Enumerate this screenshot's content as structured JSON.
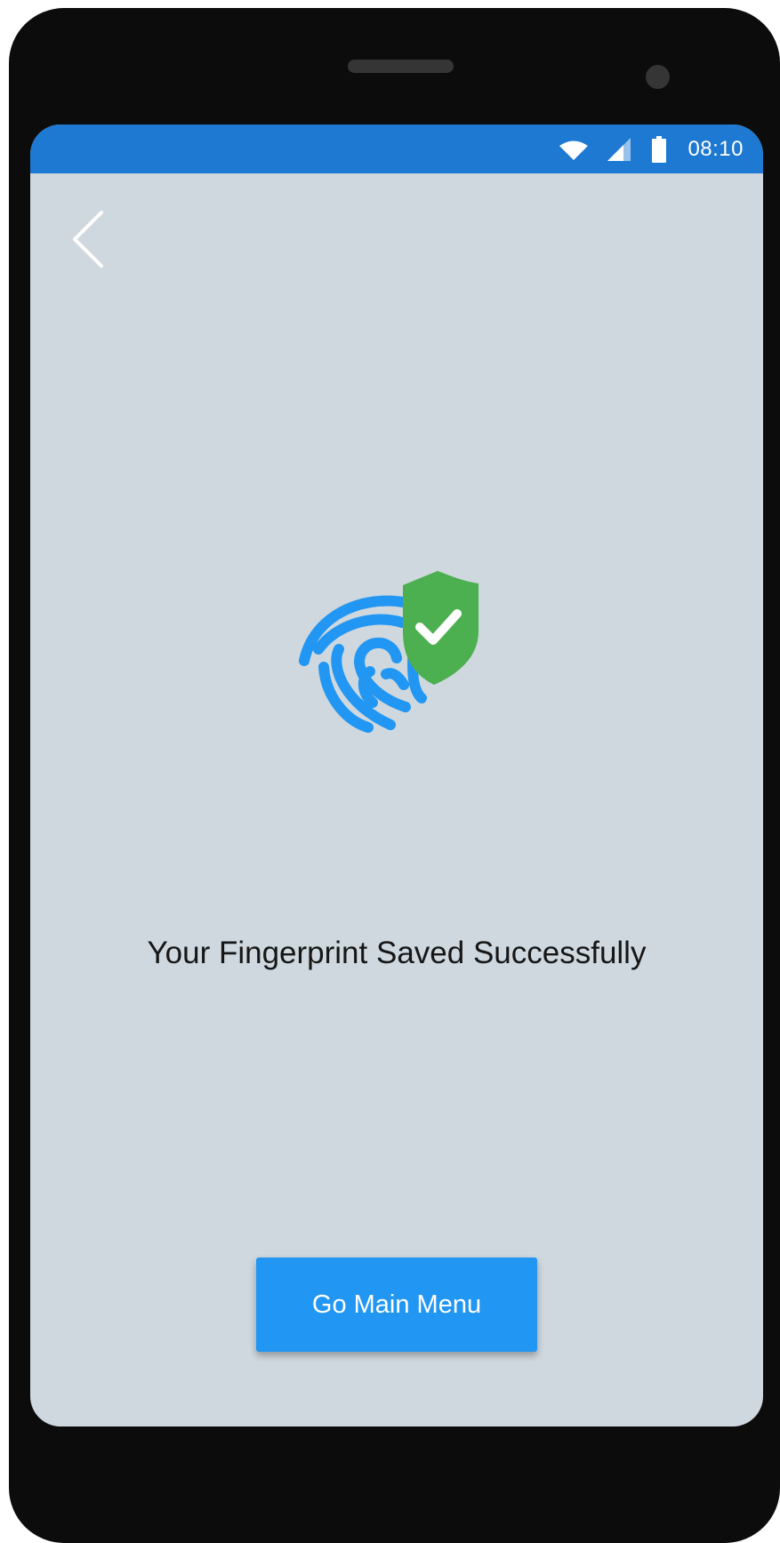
{
  "status_bar": {
    "time": "08:10",
    "icons": [
      "wifi-icon",
      "signal-icon",
      "battery-icon"
    ],
    "background_color": "#1d79d1"
  },
  "nav": {
    "back_icon": "chevron-left-icon"
  },
  "illustration": {
    "icons": [
      "fingerprint-icon",
      "shield-check-icon"
    ],
    "fingerprint_color": "#2196f3",
    "shield_color": "#4caf50"
  },
  "message": "Your Fingerprint Saved Successfully",
  "actions": {
    "main_menu_label": "Go Main Menu",
    "button_color": "#2196f3"
  },
  "colors": {
    "screen_background": "#cfd8de",
    "device_frame": "#0c0c0c"
  }
}
